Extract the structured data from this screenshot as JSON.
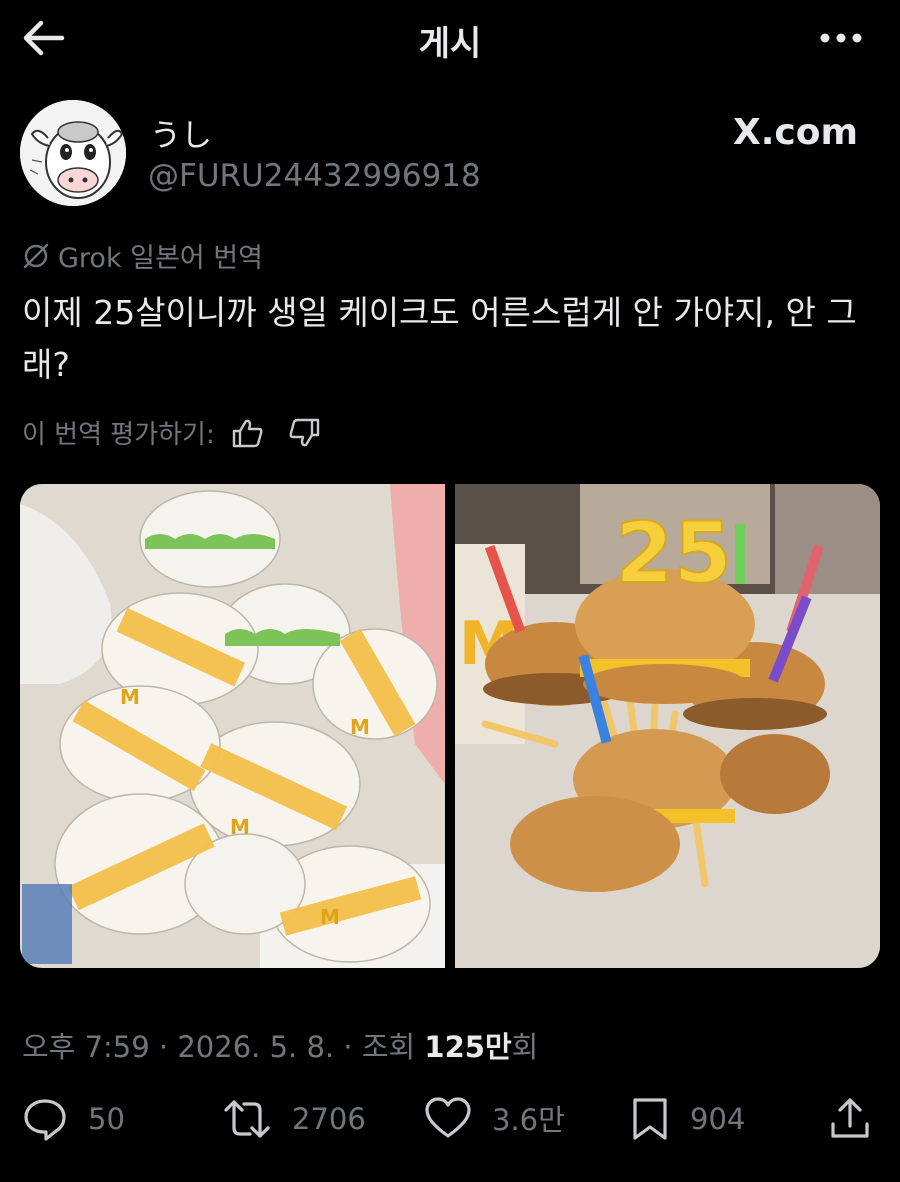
{
  "header": {
    "title": "게시"
  },
  "author": {
    "name": "うし",
    "handle": "@FURU24432996918",
    "source_label": "X.com"
  },
  "post": {
    "translation_label": "Grok 일본어 번역",
    "text": "이제 25살이니까 생일 케이크도 어른스럽게 안 가야지, 안 그래?",
    "rate_translation_label": "이 번역 평가하기:"
  },
  "meta": {
    "time": "오후 7:59",
    "date": "2026. 5. 8.",
    "views_prefix": "조회",
    "views_count": "125만",
    "views_suffix": "회",
    "separator": "·"
  },
  "actions": {
    "replies": "50",
    "reposts": "2706",
    "likes": "3.6만",
    "bookmarks": "904"
  },
  "media": [
    {
      "label": "Cheeseburger"
    },
    {
      "label": "25"
    }
  ],
  "colors": {
    "background": "#000000",
    "text_primary": "#e7e9ea",
    "text_secondary": "#71767b"
  },
  "icons": {
    "back": "arrow-left-icon",
    "more": "more-icon",
    "grok": "grok-icon",
    "thumbs_up": "thumbs-up-icon",
    "thumbs_down": "thumbs-down-icon",
    "reply": "reply-icon",
    "repost": "repost-icon",
    "like": "heart-icon",
    "bookmark": "bookmark-icon",
    "share": "share-icon"
  }
}
